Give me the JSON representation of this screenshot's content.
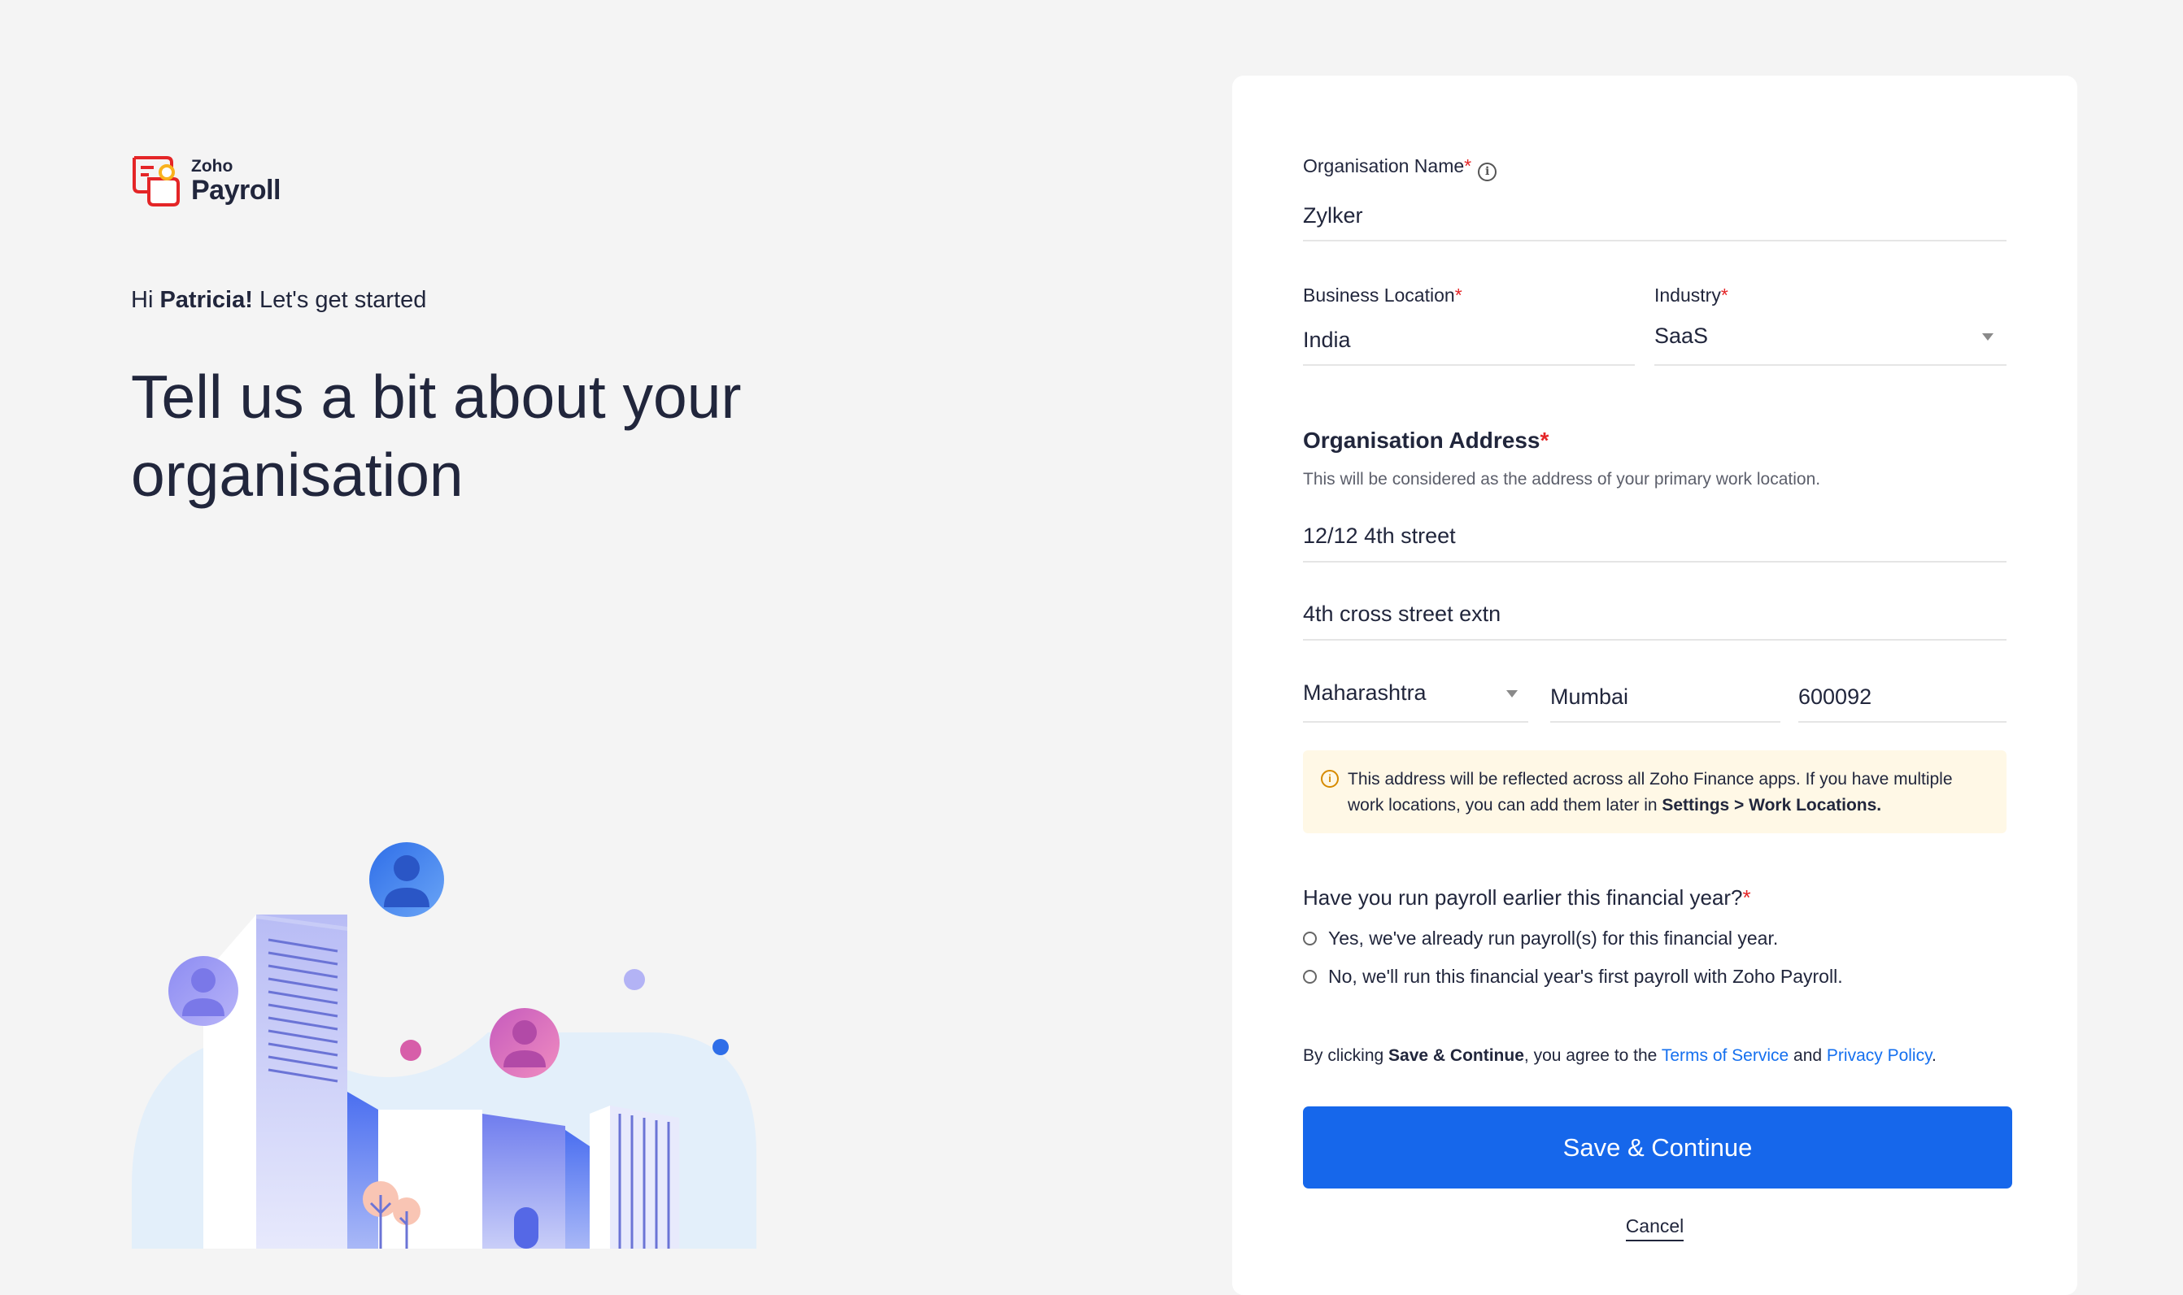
{
  "brand": {
    "company": "Zoho",
    "product": "Payroll",
    "colors": {
      "logo_red": "#e42527",
      "logo_yellow": "#f9b21d"
    }
  },
  "intro": {
    "greeting_prefix": "Hi ",
    "user_name": "Patricia!",
    "greeting_suffix": " Let's get started",
    "headline_line1": "Tell us a bit about your",
    "headline_line2": "organisation"
  },
  "form": {
    "org_name": {
      "label": "Organisation Name",
      "required_mark": "*",
      "value": "Zylker"
    },
    "business_location": {
      "label": "Business Location",
      "required_mark": "*",
      "value": "India"
    },
    "industry": {
      "label": "Industry",
      "required_mark": "*",
      "value": "SaaS"
    },
    "address": {
      "title": "Organisation Address",
      "required_mark": "*",
      "hint": "This will be considered as the address of your primary work location.",
      "street1": "12/12 4th street",
      "street2": "4th cross street extn",
      "state": "Maharashtra",
      "city": "Mumbai",
      "zip": "600092"
    },
    "notice": {
      "text": "This address will be reflected across all Zoho Finance apps. If you have multiple work locations, you can add them later in ",
      "path": "Settings > Work Locations",
      "end": "."
    },
    "payroll_question": {
      "question": "Have you run payroll earlier this financial year?",
      "required_mark": "*",
      "options": [
        "Yes, we've already run payroll(s) for this financial year.",
        "No, we'll run this financial year's first payroll with Zoho Payroll."
      ]
    },
    "terms": {
      "prefix": "By clicking ",
      "button_ref": "Save & Continue",
      "middle": ", you agree to the ",
      "tos": "Terms of Service",
      "and": " and ",
      "privacy": "Privacy Policy",
      "end": "."
    },
    "save_label": "Save & Continue",
    "cancel_label": "Cancel",
    "colors": {
      "primary": "#1667eb",
      "required": "#e42527",
      "link": "#1570ef",
      "notice_bg": "#fff8e6"
    }
  }
}
